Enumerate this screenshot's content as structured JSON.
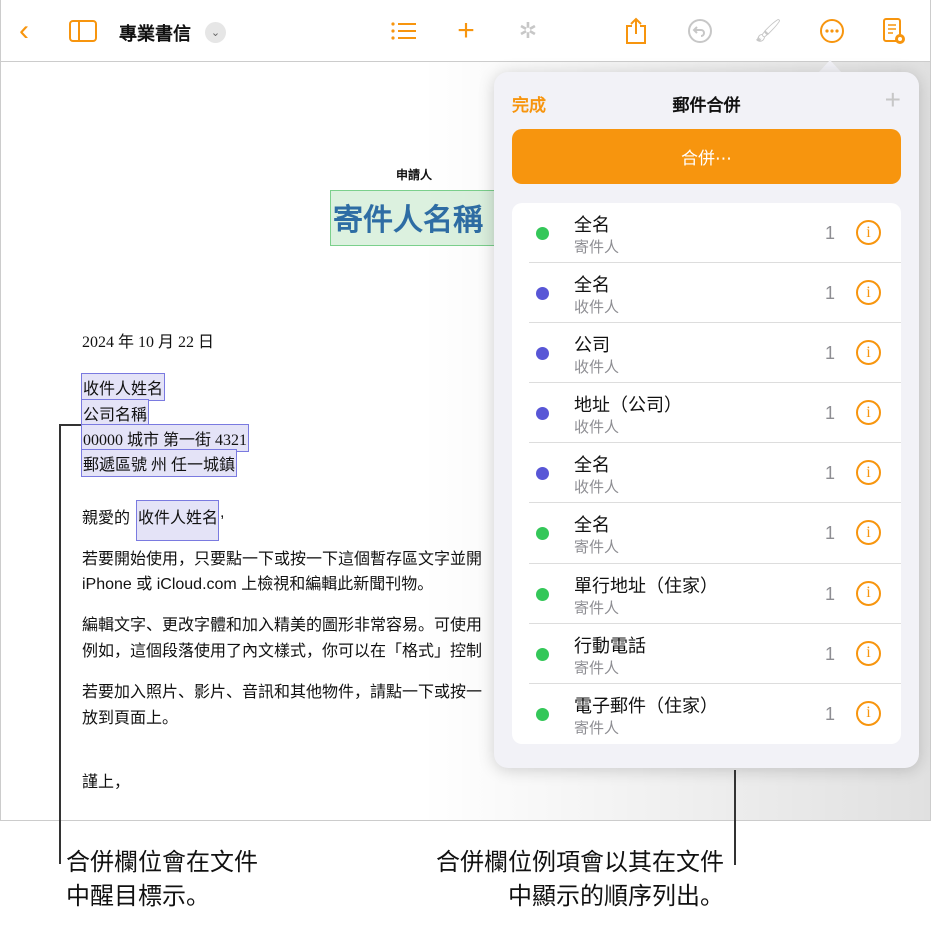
{
  "toolbar": {
    "title": "專業書信",
    "icons": [
      "back-icon",
      "sidebar-icon",
      "chevron-down-icon",
      "list-icon",
      "plus-icon",
      "collaborate-icon",
      "share-icon",
      "undo-icon",
      "format-brush-icon",
      "more-icon",
      "document-view-icon"
    ]
  },
  "document": {
    "sender_label": "申請人",
    "sender_field": "寄件人名稱",
    "date": "2024 年 10 月 22 日",
    "address": [
      "收件人姓名",
      "公司名稱",
      "00000 城市 第一街 4321",
      "郵遞區號 州 任一城鎮"
    ],
    "greeting_prefix": "親愛的",
    "greeting_field": "收件人姓名",
    "greeting_suffix": ",",
    "paragraphs": [
      "若要開始使用，只要點一下或按一下這個暫存區文字並開",
      "iPhone 或 iCloud.com 上檢視和編輯此新聞刊物。",
      "編輯文字、更改字體和加入精美的圖形非常容易。可使用",
      "例如，這個段落使用了內文樣式，你可以在「格式」控制",
      "若要加入照片、影片、音訊和其他物件，請點一下或按一",
      "放到頁面上。"
    ],
    "closing": "謹上，"
  },
  "popover": {
    "done_label": "完成",
    "title": "郵件合併",
    "merge_label": "合併⋯",
    "colors": {
      "sender": "#34c759",
      "recipient": "#5856d6",
      "accent": "#f7950e"
    },
    "fields": [
      {
        "name": "全名",
        "source": "寄件人",
        "count": "1",
        "type": "sender"
      },
      {
        "name": "全名",
        "source": "收件人",
        "count": "1",
        "type": "recipient"
      },
      {
        "name": "公司",
        "source": "收件人",
        "count": "1",
        "type": "recipient"
      },
      {
        "name": "地址（公司）",
        "source": "收件人",
        "count": "1",
        "type": "recipient"
      },
      {
        "name": "全名",
        "source": "收件人",
        "count": "1",
        "type": "recipient"
      },
      {
        "name": "全名",
        "source": "寄件人",
        "count": "1",
        "type": "sender"
      },
      {
        "name": "單行地址（住家）",
        "source": "寄件人",
        "count": "1",
        "type": "sender"
      },
      {
        "name": "行動電話",
        "source": "寄件人",
        "count": "1",
        "type": "sender"
      },
      {
        "name": "電子郵件（住家）",
        "source": "寄件人",
        "count": "1",
        "type": "sender"
      }
    ]
  },
  "callouts": {
    "left": [
      "合併欄位會在文件",
      "中醒目標示。"
    ],
    "right": [
      "合併欄位例項會以其在文件",
      "中顯示的順序列出。"
    ]
  }
}
